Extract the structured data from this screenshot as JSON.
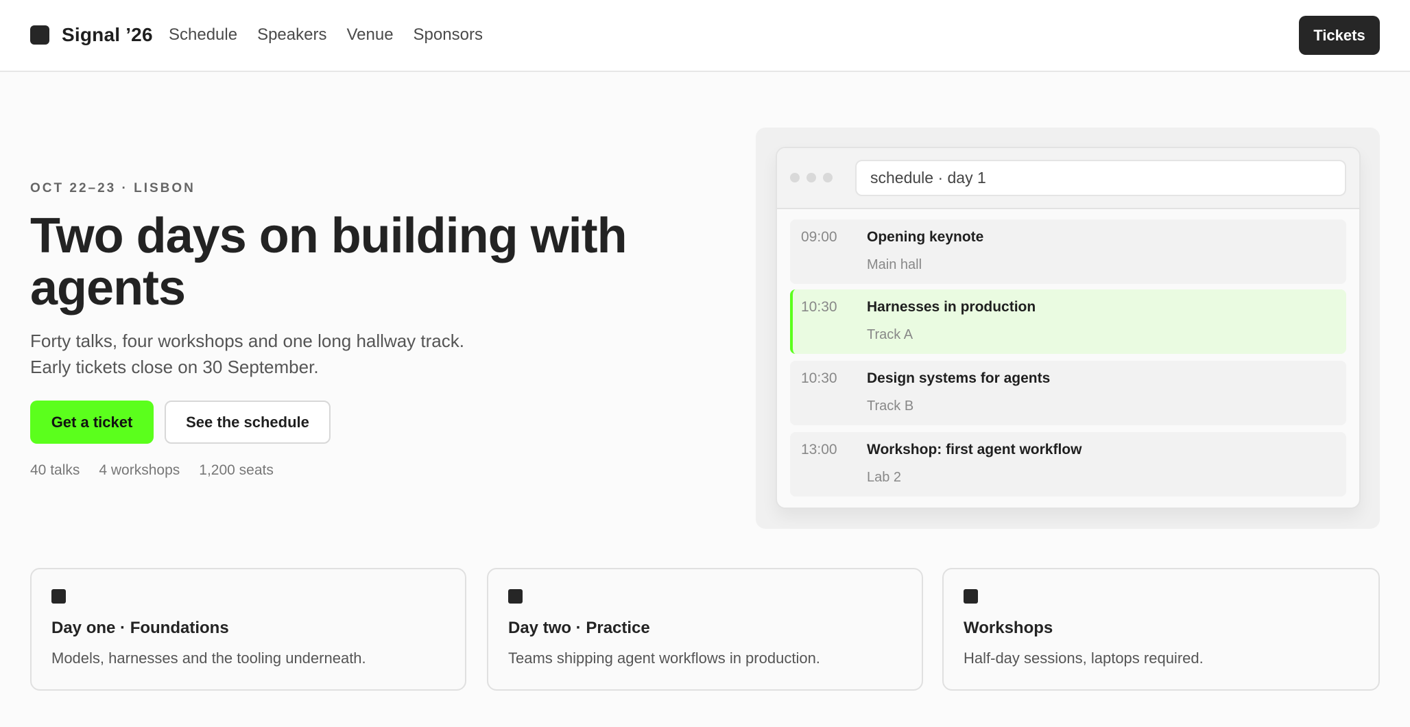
{
  "nav": {
    "brand": "Signal ’26",
    "links": [
      "Schedule",
      "Speakers",
      "Venue",
      "Sponsors"
    ],
    "tickets_label": "Tickets"
  },
  "hero": {
    "eyebrow": "OCT 22–23 · LISBON",
    "title": "Two days on building with agents",
    "subtitle": "Forty talks, four workshops and one long hallway track. Early tickets close on 30 September.",
    "primary_cta": "Get a ticket",
    "secondary_cta": "See the schedule",
    "stats": [
      "40 talks",
      "4 workshops",
      "1,200 seats"
    ]
  },
  "schedule_window": {
    "address": "schedule · day 1",
    "sessions": [
      {
        "time": "09:00",
        "title": "Opening keynote",
        "room": "Main hall",
        "highlighted": false
      },
      {
        "time": "10:30",
        "title": "Harnesses in production",
        "room": "Track A",
        "highlighted": true
      },
      {
        "time": "10:30",
        "title": "Design systems for agents",
        "room": "Track B",
        "highlighted": false
      },
      {
        "time": "13:00",
        "title": "Workshop: first agent workflow",
        "room": "Lab 2",
        "highlighted": false
      }
    ]
  },
  "cards": [
    {
      "title": "Day one · Foundations",
      "description": "Models, harnesses and the tooling underneath."
    },
    {
      "title": "Day two · Practice",
      "description": "Teams shipping agent workflows in production."
    },
    {
      "title": "Workshops",
      "description": "Half-day sessions, laptops required."
    }
  ],
  "colors": {
    "accent": "#5bff1c",
    "highlight_bg": "#eafbe1",
    "dark": "#262626"
  }
}
